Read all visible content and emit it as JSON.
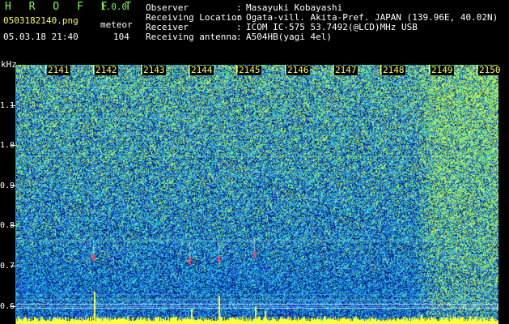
{
  "header": {
    "brand": "H R O F F T",
    "version": "1.0.0",
    "filename": "0503182140.png",
    "datetime": "05.03.18 21:40",
    "meteor_label": "meteor",
    "meteor_count": "104"
  },
  "info": [
    {
      "key": "Observer",
      "value": "Masayuki Kobayashi"
    },
    {
      "key": "Receiving Location",
      "value": "Ogata-vill. Akita-Pref. JAPAN (139.96E, 40.02N)"
    },
    {
      "key": "Receiver",
      "value": "ICOM IC-575 53.7492(@LCD)MHz USB"
    },
    {
      "key": "Receiving antenna",
      "value": "A504HB(yagi 4el)"
    }
  ],
  "spectrogram": {
    "y_unit": "kHz",
    "y_ticks": [
      "1.1",
      "1.0",
      "0.9",
      "0.8",
      "0.7",
      "0.6"
    ],
    "x_ticks": [
      "2141",
      "2142",
      "2143",
      "2144",
      "2145",
      "2146",
      "2147",
      "2148",
      "2149",
      "2150"
    ],
    "colors": {
      "background": "#000000",
      "deep": "#0a2aa0",
      "mid": "#1e6cff",
      "bright": "#25d9d0",
      "hot": "#ffff3a",
      "echo": "#ff3a6a",
      "text": "#ffffff",
      "accent": "#7cff4a"
    }
  }
}
